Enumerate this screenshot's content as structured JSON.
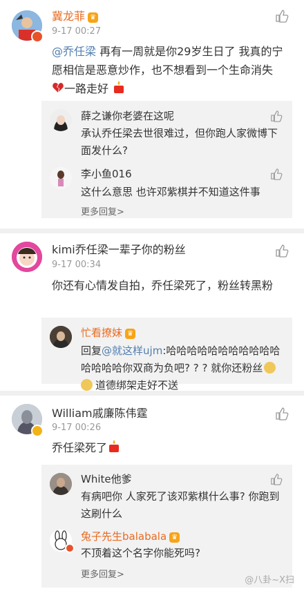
{
  "comments": [
    {
      "name": "冀龙菲",
      "vip": "♛",
      "time": "9-17 00:27",
      "mention": "@乔任梁",
      "text_a": " 再有一周就是你29岁生日了 我真的宁愿相信是恶意炒作，也不想看到一个生命消失 ",
      "text_b": "一路走好 ",
      "replies": [
        {
          "name": "薛之谦你老婆在这呢",
          "text": "承认乔任梁去世很难过，但你跑人家微博下面发什么?"
        },
        {
          "name": "李小鱼016",
          "text": "这什么意思 也许邓紫棋并不知道这件事"
        }
      ],
      "more": "更多回复>"
    },
    {
      "name": "kimi乔任梁一辈子你的粉丝",
      "time": "9-17 00:34",
      "text": "你还有心情发自拍，乔任梁死了，粉丝转黑粉",
      "replies": [
        {
          "name": "忙看撩妹",
          "vip": "♛",
          "text_prefix": "回复",
          "mention": "@就这样ujm",
          "text_a": ":哈哈哈哈哈哈哈哈哈哈哈哈哈哈哈你双商为负吧? ? ? 就你还粉丝",
          "text_b": "道德绑架走好不送"
        }
      ]
    },
    {
      "name": "William戚廉陈伟霆",
      "time": "9-17 00:26",
      "text": "乔任梁死了",
      "replies": [
        {
          "name": "White他爹",
          "text": "有病吧你 人家死了该邓紫棋什么事? 你跑到这刷什么"
        },
        {
          "name": "兔子先生balabala",
          "vip": "♛",
          "text": "不顶着这个名字你能死吗?"
        }
      ],
      "more": "更多回复>"
    }
  ],
  "watermark": "@八卦~X扫"
}
